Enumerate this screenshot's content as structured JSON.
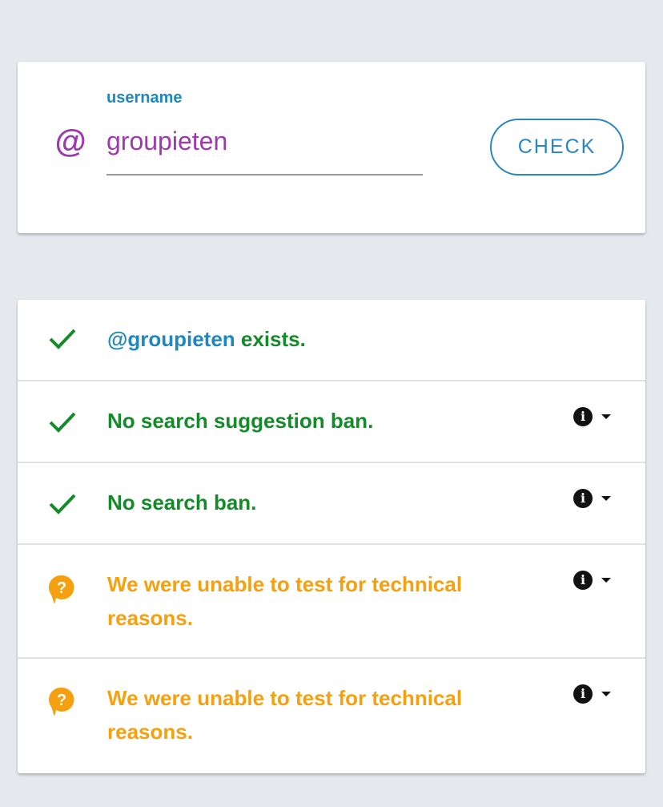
{
  "search": {
    "at_symbol": "@",
    "label": "username",
    "value": "groupieten",
    "button_label": "CHECK"
  },
  "results": {
    "exists": {
      "handle": "@groupieten",
      "text": " exists.",
      "status": "ok"
    },
    "rows": [
      {
        "text": "No search suggestion ban.",
        "status": "ok"
      },
      {
        "text": "No search ban.",
        "status": "ok"
      },
      {
        "text": "We were unable to test for technical reasons.",
        "status": "unknown"
      },
      {
        "text": "We were unable to test for technical reasons.",
        "status": "unknown"
      }
    ],
    "info_glyph": "i"
  },
  "colors": {
    "ok": "#148a2a",
    "warn": "#f5a00f",
    "accent": "#1f87bd",
    "username": "#9c3aae"
  }
}
